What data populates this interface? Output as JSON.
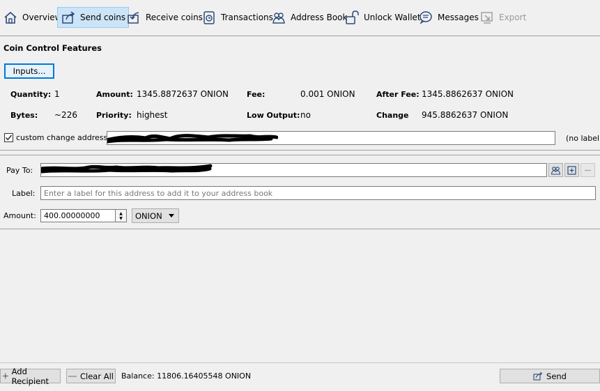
{
  "toolbar": {
    "overview": "Overview",
    "send_coins": "Send coins",
    "receive_coins": "Receive coins",
    "transactions": "Transactions",
    "address_book": "Address Book",
    "unlock_wallet": "Unlock Wallet",
    "messages": "Messages",
    "export": "Export"
  },
  "coin_control": {
    "title": "Coin Control Features",
    "inputs_button": "Inputs...",
    "quantity_label": "Quantity:",
    "quantity_value": "1",
    "amount_label": "Amount:",
    "amount_value": "1345.8872637 ONION",
    "fee_label": "Fee:",
    "fee_value": "0.001 ONION",
    "after_fee_label": "After Fee:",
    "after_fee_value": "1345.8862637 ONION",
    "bytes_label": "Bytes:",
    "bytes_value": "~226",
    "priority_label": "Priority:",
    "priority_value": "highest",
    "low_output_label": "Low Output:",
    "low_output_value": "no",
    "change_label": "Change",
    "change_value": "945.8862637 ONION",
    "custom_change_label": "custom change address",
    "custom_change_checked": true,
    "change_address_label": "(no label)"
  },
  "recipient": {
    "pay_to_label": "Pay To:",
    "label_label": "Label:",
    "label_placeholder": "Enter a label for this address to add it to your address book",
    "amount_label": "Amount:",
    "amount_value": "400.00000000",
    "unit": "ONION"
  },
  "footer": {
    "add_recipient": "Add Recipient",
    "clear_all": "Clear All",
    "balance": "Balance: 11806.16405548 ONION",
    "send": "Send"
  },
  "colors": {
    "accent": "#0078d7",
    "active_tab_bg": "#cce4f7",
    "toolbar_icon": "#2b4a7a"
  }
}
